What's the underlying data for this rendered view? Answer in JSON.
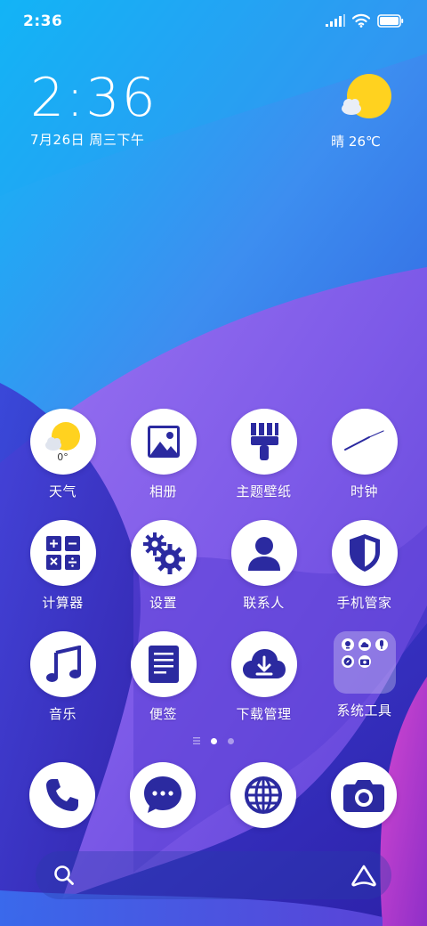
{
  "status_bar": {
    "time": "2:36",
    "icons": [
      "signal-icon",
      "wifi-icon",
      "battery-icon"
    ]
  },
  "clock_widget": {
    "time": "2:36",
    "date": "7月26日 周三下午"
  },
  "weather_widget": {
    "condition": "晴 26℃",
    "icon": "sun-cloud-icon"
  },
  "apps": [
    {
      "label": "天气",
      "icon": "weather-icon",
      "badge_text": "0°"
    },
    {
      "label": "相册",
      "icon": "gallery-icon"
    },
    {
      "label": "主题壁纸",
      "icon": "brush-icon"
    },
    {
      "label": "时钟",
      "icon": "clock-icon"
    },
    {
      "label": "计算器",
      "icon": "calculator-icon"
    },
    {
      "label": "设置",
      "icon": "gear-icon"
    },
    {
      "label": "联系人",
      "icon": "contact-icon"
    },
    {
      "label": "手机管家",
      "icon": "shield-icon"
    },
    {
      "label": "音乐",
      "icon": "music-icon"
    },
    {
      "label": "便签",
      "icon": "notes-icon"
    },
    {
      "label": "下载管理",
      "icon": "download-icon"
    },
    {
      "label": "系统工具",
      "icon": "folder-icon"
    }
  ],
  "page_indicator": {
    "pages": 2,
    "current": 1
  },
  "dock": [
    {
      "icon": "phone-icon"
    },
    {
      "icon": "message-icon"
    },
    {
      "icon": "browser-icon"
    },
    {
      "icon": "camera-icon"
    }
  ],
  "search_bar": {
    "left_icon": "search-icon",
    "right_icon": "assistant-icon"
  },
  "colors": {
    "icon_glyph": "#2b2aa0",
    "accent_yellow": "#ffd21f",
    "wallpaper_top": "#14b4f5",
    "wallpaper_purple": "#8a5cf0",
    "wallpaper_magenta": "#c33fd8"
  }
}
